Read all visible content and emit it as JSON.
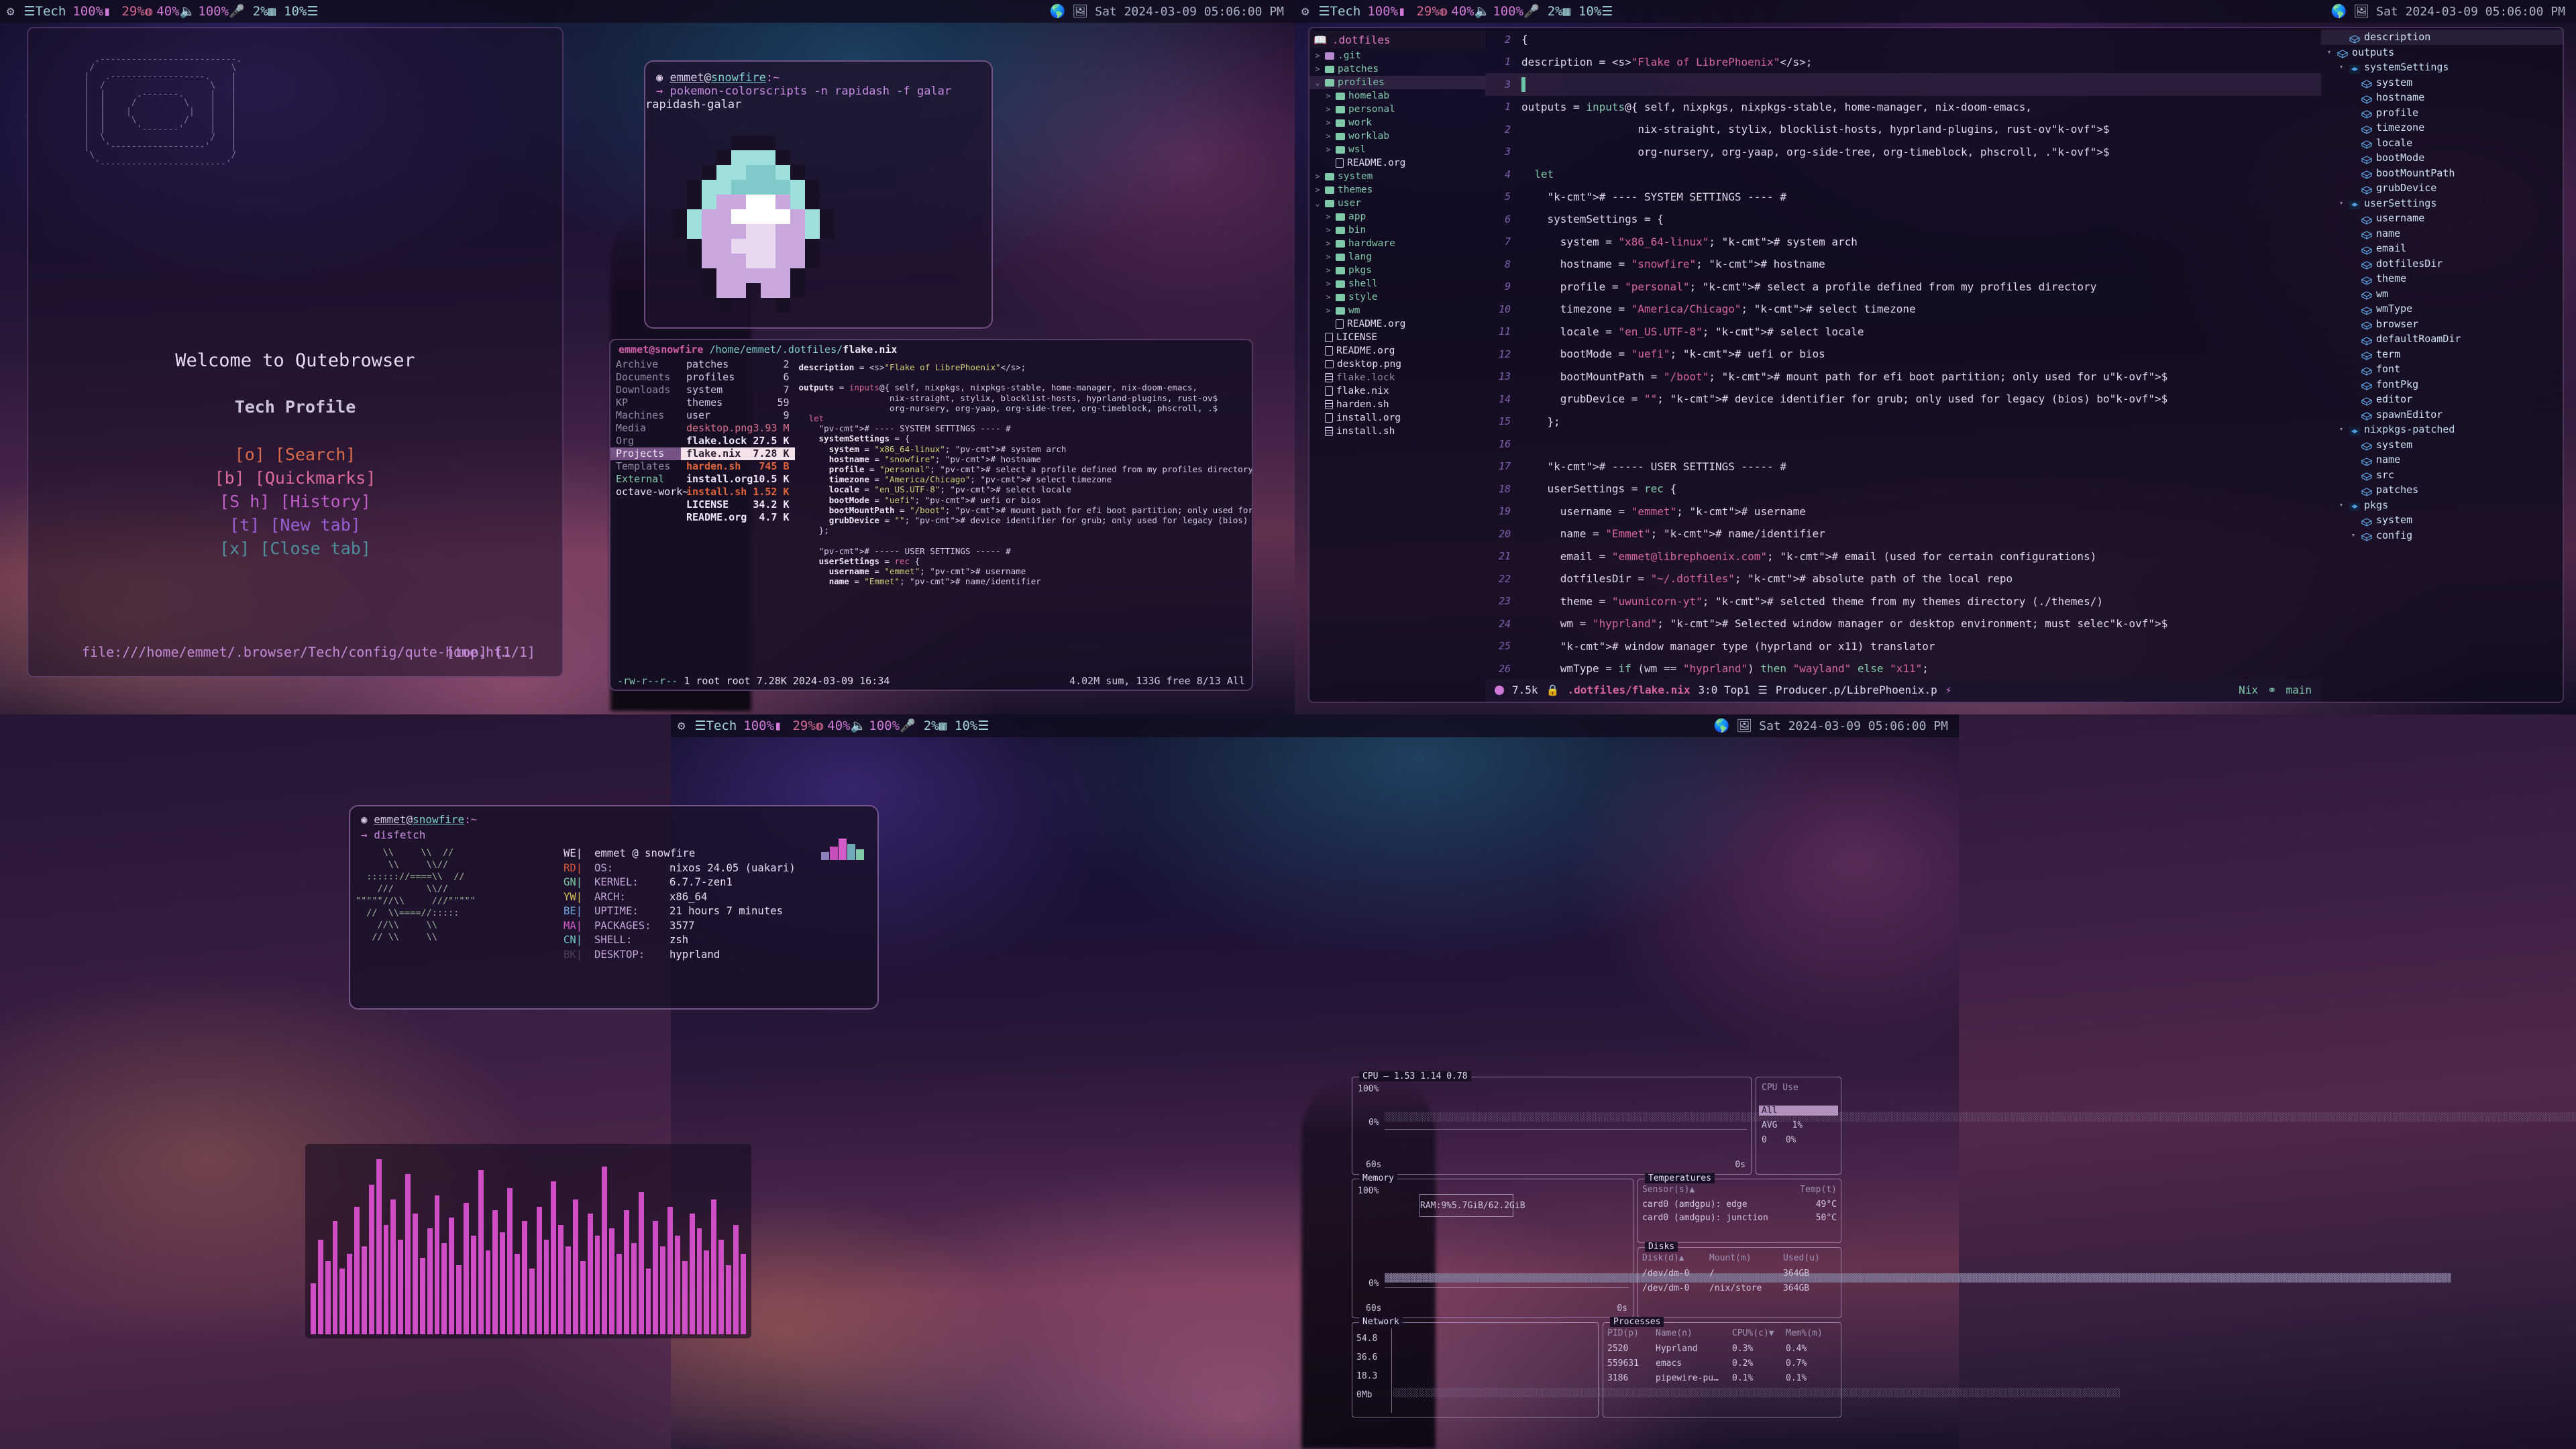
{
  "bar": {
    "left_icons": [
      "gear-icon",
      "layers-icon"
    ],
    "workspace": "Tech",
    "battery_pct": "100%",
    "battery_icon": "battery-icon",
    "cpu_pct": "29%",
    "cpu_icon": "cpu-circle-icon",
    "brightness_pct": "40%",
    "volume_icon": "speaker-icon",
    "volume_pct": "100%",
    "mic_icon": "microphone-icon",
    "mic_pct": "2%",
    "ram_icon": "memory-icon",
    "ram_pct": "10%",
    "menu_icon": "hamburger-icon",
    "datetime": "Sat 2024-03-09 05:06:00 PM",
    "tray": [
      "globe-icon",
      "image-icon"
    ]
  },
  "qutebrowser": {
    "welcome": "Welcome to Qutebrowser",
    "profile": "Tech Profile",
    "links": [
      {
        "key": "[o]",
        "label": "[Search]"
      },
      {
        "key": "[b]",
        "label": "[Quickmarks]"
      },
      {
        "key": "[S h]",
        "label": "[History]"
      },
      {
        "key": "[t]",
        "label": "[New tab]"
      },
      {
        "key": "[x]",
        "label": "[Close tab]"
      }
    ],
    "url": "file:///home/emmet/.browser/Tech/config/qute-home.ht…",
    "position": "[top] [1/1]",
    "ascii_art": "     .--------------------------.\n    /                          \\\n   |   .------------------.    |\n   |  /                    \\   |\n   |  |      .-------.     |   |\n   |  |     /         \\    |   |\n   |  |    |           |   |   |\n   |  |     \\         /    |   |\n   |  |      '-------'     |   |\n   |  \\                    /   |\n   |   '------------------'    |\n    \\                          /\n     '------------------------'"
  },
  "pokemon_terminal": {
    "prompt_user": "emmet",
    "prompt_at": "@",
    "prompt_host": "snowfire",
    "prompt_path": ":~",
    "arrow": "→",
    "command": "pokemon-colorscripts -n rapidash -f galar",
    "output": "rapidash-galar"
  },
  "file_manager": {
    "header_user": "emmet@snowfire",
    "header_path": "/home/emmet/.dotfiles/",
    "header_file": "flake.nix",
    "left_column": [
      {
        "name": "Archive",
        "style": "dim"
      },
      {
        "name": "Documents",
        "style": "dim"
      },
      {
        "name": "Downloads",
        "style": "dim"
      },
      {
        "name": "KP",
        "style": "dim"
      },
      {
        "name": "Machines",
        "style": "dim"
      },
      {
        "name": "Media",
        "style": "dim"
      },
      {
        "name": "Org",
        "style": "dim"
      },
      {
        "name": "Projects",
        "style": "selected"
      },
      {
        "name": "Templates",
        "style": "dim"
      },
      {
        "name": "External",
        "style": "ext"
      },
      {
        "name": "octave-work~",
        "style": "oct"
      }
    ],
    "middle_column": [
      {
        "name": "patches",
        "size": "2",
        "kind": "dir"
      },
      {
        "name": "profiles",
        "size": "6",
        "kind": "dir"
      },
      {
        "name": "system",
        "size": "7",
        "kind": "dir"
      },
      {
        "name": "themes",
        "size": "59",
        "kind": "dir"
      },
      {
        "name": "user",
        "size": "9",
        "kind": "dir"
      },
      {
        "name": "desktop.png",
        "size": "3.93 M",
        "kind": "image"
      },
      {
        "name": "flake.lock",
        "size": "27.5 K",
        "kind": "plain"
      },
      {
        "name": "flake.nix",
        "size": "7.28 K",
        "kind": "selected"
      },
      {
        "name": "harden.sh",
        "size": "745 B",
        "kind": "script"
      },
      {
        "name": "install.org",
        "size": "10.5 K",
        "kind": "plain"
      },
      {
        "name": "install.sh",
        "size": "1.52 K",
        "kind": "script"
      },
      {
        "name": "LICENSE",
        "size": "34.2 K",
        "kind": "plain"
      },
      {
        "name": "README.org",
        "size": "4.7 K",
        "kind": "plain"
      }
    ],
    "status_perm": "-rw-r--r--",
    "status_meta": "1 root root 7.28K 2024-03-09 16:34",
    "status_right": "4.02M sum, 133G free  8/13  All"
  },
  "emacs": {
    "treemacs": {
      "root": ".dotfiles",
      "root_icon": "book-icon",
      "items": [
        {
          "label": ".git",
          "type": "folder-purple",
          "arrow": ">",
          "depth": 0
        },
        {
          "label": "patches",
          "type": "folder",
          "arrow": ">",
          "depth": 0
        },
        {
          "label": "profiles",
          "type": "folder",
          "arrow": "v",
          "depth": 0,
          "highlight": true
        },
        {
          "label": "homelab",
          "type": "folder",
          "arrow": ">",
          "depth": 1
        },
        {
          "label": "personal",
          "type": "folder",
          "arrow": ">",
          "depth": 1
        },
        {
          "label": "work",
          "type": "folder",
          "arrow": ">",
          "depth": 1
        },
        {
          "label": "worklab",
          "type": "folder",
          "arrow": ">",
          "depth": 1
        },
        {
          "label": "wsl",
          "type": "folder",
          "arrow": ">",
          "depth": 1
        },
        {
          "label": "README.org",
          "type": "doc",
          "arrow": "",
          "depth": 1
        },
        {
          "label": "system",
          "type": "folder",
          "arrow": ">",
          "depth": 0
        },
        {
          "label": "themes",
          "type": "folder",
          "arrow": ">",
          "depth": 0
        },
        {
          "label": "user",
          "type": "folder",
          "arrow": "v",
          "depth": 0
        },
        {
          "label": "app",
          "type": "folder",
          "arrow": ">",
          "depth": 1
        },
        {
          "label": "bin",
          "type": "folder",
          "arrow": ">",
          "depth": 1
        },
        {
          "label": "hardware",
          "type": "folder",
          "arrow": ">",
          "depth": 1
        },
        {
          "label": "lang",
          "type": "folder",
          "arrow": ">",
          "depth": 1
        },
        {
          "label": "pkgs",
          "type": "folder",
          "arrow": ">",
          "depth": 1
        },
        {
          "label": "shell",
          "type": "folder",
          "arrow": ">",
          "depth": 1
        },
        {
          "label": "style",
          "type": "folder",
          "arrow": ">",
          "depth": 1
        },
        {
          "label": "wm",
          "type": "folder",
          "arrow": ">",
          "depth": 1
        },
        {
          "label": "README.org",
          "type": "doc",
          "arrow": "",
          "depth": 1
        },
        {
          "label": "LICENSE",
          "type": "doc",
          "arrow": "",
          "depth": 0
        },
        {
          "label": "README.org",
          "type": "doc",
          "arrow": "",
          "depth": 0
        },
        {
          "label": "desktop.png",
          "type": "img",
          "arrow": "",
          "depth": 0
        },
        {
          "label": "flake.lock",
          "type": "bin",
          "arrow": "",
          "depth": 0,
          "dim": true
        },
        {
          "label": "flake.nix",
          "type": "doc",
          "arrow": "",
          "depth": 0
        },
        {
          "label": "harden.sh",
          "type": "bin",
          "arrow": "",
          "depth": 0
        },
        {
          "label": "install.org",
          "type": "doc",
          "arrow": "",
          "depth": 0
        },
        {
          "label": "install.sh",
          "type": "bin",
          "arrow": "",
          "depth": 0
        }
      ]
    },
    "code_lines": [
      {
        "num": "2",
        "indent": 0,
        "html": "{"
      },
      {
        "num": "1",
        "indent": 0,
        "html": "description = <s>\"Flake of LibrePhoenix\"</s>;"
      },
      {
        "num": "3",
        "indent": 0,
        "html": "",
        "current": true
      },
      {
        "num": "1",
        "indent": 0,
        "html": "outputs = inputs@{ self, nixpkgs, nixpkgs-stable, home-manager, nix-doom-emacs,"
      },
      {
        "num": "2",
        "indent": 0,
        "html": "                  nix-straight, stylix, blocklist-hosts, hyprland-plugins, rust-ov$"
      },
      {
        "num": "3",
        "indent": 0,
        "html": "                  org-nursery, org-yaap, org-side-tree, org-timeblock, phscroll, .$"
      },
      {
        "num": "4",
        "indent": 0,
        "html": "  let"
      },
      {
        "num": "5",
        "indent": 0,
        "html": "    # ---- SYSTEM SETTINGS ---- #"
      },
      {
        "num": "6",
        "indent": 0,
        "html": "    systemSettings = {"
      },
      {
        "num": "7",
        "indent": 0,
        "html": "      system = \"x86_64-linux\"; # system arch"
      },
      {
        "num": "8",
        "indent": 0,
        "html": "      hostname = \"snowfire\"; # hostname"
      },
      {
        "num": "9",
        "indent": 0,
        "html": "      profile = \"personal\"; # select a profile defined from my profiles directory"
      },
      {
        "num": "10",
        "indent": 0,
        "html": "      timezone = \"America/Chicago\"; # select timezone"
      },
      {
        "num": "11",
        "indent": 0,
        "html": "      locale = \"en_US.UTF-8\"; # select locale"
      },
      {
        "num": "12",
        "indent": 0,
        "html": "      bootMode = \"uefi\"; # uefi or bios"
      },
      {
        "num": "13",
        "indent": 0,
        "html": "      bootMountPath = \"/boot\"; # mount path for efi boot partition; only used for u$"
      },
      {
        "num": "14",
        "indent": 0,
        "html": "      grubDevice = \"\"; # device identifier for grub; only used for legacy (bios) bo$"
      },
      {
        "num": "15",
        "indent": 0,
        "html": "    };"
      },
      {
        "num": "16",
        "indent": 0,
        "html": ""
      },
      {
        "num": "17",
        "indent": 0,
        "html": "    # ----- USER SETTINGS ----- #"
      },
      {
        "num": "18",
        "indent": 0,
        "html": "    userSettings = rec {"
      },
      {
        "num": "19",
        "indent": 0,
        "html": "      username = \"emmet\"; # username"
      },
      {
        "num": "20",
        "indent": 0,
        "html": "      name = \"Emmet\"; # name/identifier"
      },
      {
        "num": "21",
        "indent": 0,
        "html": "      email = \"emmet@librephoenix.com\"; # email (used for certain configurations)"
      },
      {
        "num": "22",
        "indent": 0,
        "html": "      dotfilesDir = \"~/.dotfiles\"; # absolute path of the local repo"
      },
      {
        "num": "23",
        "indent": 0,
        "html": "      theme = \"uwunicorn-yt\"; # selcted theme from my themes directory (./themes/)"
      },
      {
        "num": "24",
        "indent": 0,
        "html": "      wm = \"hyprland\"; # Selected window manager or desktop environment; must selec$"
      },
      {
        "num": "25",
        "indent": 0,
        "html": "      # window manager type (hyprland or x11) translator"
      },
      {
        "num": "26",
        "indent": 0,
        "html": "      wmType = if (wm == \"hyprland\") then \"wayland\" else \"x11\";"
      }
    ],
    "modeline": {
      "size": "7.5k",
      "lock_icon": "lock-icon",
      "filename": ".dotfiles/flake.nix",
      "position": "3:0 Top1",
      "project_icon": "layers-icon",
      "project": "Producer.p/LibrePhoenix.p",
      "flash_icon": "flash-icon",
      "major_mode": "Nix",
      "branch_icon": "git-branch-icon",
      "branch": "main"
    },
    "imenu": [
      {
        "label": "description",
        "depth": 1,
        "icon": "cube",
        "arrow": "",
        "highlight": true
      },
      {
        "label": "outputs",
        "depth": 0,
        "icon": "cube",
        "arrow": "v"
      },
      {
        "label": "systemSettings",
        "depth": 1,
        "icon": "box",
        "arrow": "v"
      },
      {
        "label": "system",
        "depth": 2,
        "icon": "cube",
        "arrow": ""
      },
      {
        "label": "hostname",
        "depth": 2,
        "icon": "cube",
        "arrow": ""
      },
      {
        "label": "profile",
        "depth": 2,
        "icon": "cube",
        "arrow": ""
      },
      {
        "label": "timezone",
        "depth": 2,
        "icon": "cube",
        "arrow": ""
      },
      {
        "label": "locale",
        "depth": 2,
        "icon": "cube",
        "arrow": ""
      },
      {
        "label": "bootMode",
        "depth": 2,
        "icon": "cube",
        "arrow": ""
      },
      {
        "label": "bootMountPath",
        "depth": 2,
        "icon": "cube",
        "arrow": ""
      },
      {
        "label": "grubDevice",
        "depth": 2,
        "icon": "cube",
        "arrow": ""
      },
      {
        "label": "userSettings",
        "depth": 1,
        "icon": "box",
        "arrow": "v"
      },
      {
        "label": "username",
        "depth": 2,
        "icon": "cube",
        "arrow": ""
      },
      {
        "label": "name",
        "depth": 2,
        "icon": "cube",
        "arrow": ""
      },
      {
        "label": "email",
        "depth": 2,
        "icon": "cube",
        "arrow": ""
      },
      {
        "label": "dotfilesDir",
        "depth": 2,
        "icon": "cube",
        "arrow": ""
      },
      {
        "label": "theme",
        "depth": 2,
        "icon": "cube",
        "arrow": ""
      },
      {
        "label": "wm",
        "depth": 2,
        "icon": "cube",
        "arrow": ""
      },
      {
        "label": "wmType",
        "depth": 2,
        "icon": "cube",
        "arrow": ""
      },
      {
        "label": "browser",
        "depth": 2,
        "icon": "cube",
        "arrow": ""
      },
      {
        "label": "defaultRoamDir",
        "depth": 2,
        "icon": "cube",
        "arrow": ""
      },
      {
        "label": "term",
        "depth": 2,
        "icon": "cube",
        "arrow": ""
      },
      {
        "label": "font",
        "depth": 2,
        "icon": "cube",
        "arrow": ""
      },
      {
        "label": "fontPkg",
        "depth": 2,
        "icon": "cube",
        "arrow": ""
      },
      {
        "label": "editor",
        "depth": 2,
        "icon": "cube",
        "arrow": ""
      },
      {
        "label": "spawnEditor",
        "depth": 2,
        "icon": "cube",
        "arrow": ""
      },
      {
        "label": "nixpkgs-patched",
        "depth": 1,
        "icon": "box",
        "arrow": "v"
      },
      {
        "label": "system",
        "depth": 2,
        "icon": "cube",
        "arrow": ""
      },
      {
        "label": "name",
        "depth": 2,
        "icon": "cube",
        "arrow": ""
      },
      {
        "label": "src",
        "depth": 2,
        "icon": "cube",
        "arrow": ""
      },
      {
        "label": "patches",
        "depth": 2,
        "icon": "cube",
        "arrow": ""
      },
      {
        "label": "pkgs",
        "depth": 1,
        "icon": "box",
        "arrow": "v"
      },
      {
        "label": "system",
        "depth": 2,
        "icon": "cube",
        "arrow": ""
      },
      {
        "label": "config",
        "depth": 2,
        "icon": "cube",
        "arrow": "v"
      }
    ]
  },
  "fastfetch": {
    "prompt_user": "emmet",
    "prompt_host": "snowfire",
    "prompt_path": ":~",
    "arrow": "→",
    "command": "disfetch",
    "ascii": "     \\\\     \\\\  //\n      \\\\     \\\\//\n  :::::://====\\\\  //\n    ///      \\\\//\n\"\"\"\"\"//\\\\     ///\"\"\"\"\"\n  //  \\\\====//:::::\n    //\\\\     \\\\\n   // \\\\     \\\\",
    "title": "emmet @ snowfire",
    "tags": [
      "WE",
      "RD",
      "GN",
      "YW",
      "BE",
      "MA",
      "CN",
      "BK"
    ],
    "rows": [
      {
        "key": "OS:",
        "value": "nixos 24.05 (uakari)"
      },
      {
        "key": "KERNEL:",
        "value": "6.7.7-zen1"
      },
      {
        "key": "ARCH:",
        "value": "x86_64"
      },
      {
        "key": "UPTIME:",
        "value": "21 hours 7 minutes"
      },
      {
        "key": "PACKAGES:",
        "value": "3577"
      },
      {
        "key": "SHELL:",
        "value": "zsh"
      },
      {
        "key": "DESKTOP:",
        "value": "hyprland"
      }
    ]
  },
  "btop": {
    "cpu": {
      "title": "CPU",
      "load": "1.53 1.14 0.78",
      "y_top": "100%",
      "y_bot": "0%",
      "x_left": "60s",
      "x_right": "0s",
      "side_title": "CPU  Use",
      "side_all": "All",
      "side_avg_label": "AVG",
      "side_avg_value": "1%",
      "side_core0_label": "0",
      "side_core0_value": "0%"
    },
    "memory": {
      "title": "Memory",
      "y_top": "100%",
      "y_bot": "0%",
      "x_left": "60s",
      "x_right": "0s",
      "ram_label": "RAM:",
      "ram_pct": "9%",
      "ram_used": "5.7GiB/62.2GiB"
    },
    "temperatures": {
      "title": "Temperatures",
      "col_sensor": "Sensor(s)▲",
      "col_temp": "Temp(t)",
      "rows": [
        {
          "sensor": "card0 (amdgpu): edge",
          "temp": "49°C"
        },
        {
          "sensor": "card0 (amdgpu): junction",
          "temp": "50°C"
        }
      ]
    },
    "disks": {
      "title": "Disks",
      "col_disk": "Disk(d)▲",
      "col_mount": "Mount(m)",
      "col_used": "Used(u)",
      "rows": [
        {
          "disk": "/dev/dm-0",
          "mount": "/",
          "used": "364GB"
        },
        {
          "disk": "/dev/dm-0",
          "mount": "/nix/store",
          "used": "364GB"
        }
      ]
    },
    "network": {
      "title": "Network",
      "ticks": [
        "54.8",
        "36.6",
        "18.3",
        "0Mb"
      ]
    },
    "processes": {
      "title": "Processes",
      "col_pid": "PID(p)",
      "col_name": "Name(n)",
      "col_cpu": "CPU%(c)▼",
      "col_mem": "Mem%(m)",
      "rows": [
        {
          "pid": "2520",
          "name": "Hyprland",
          "cpu": "0.3%",
          "mem": "0.4%"
        },
        {
          "pid": "559631",
          "name": "emacs",
          "cpu": "0.2%",
          "mem": "0.7%"
        },
        {
          "pid": "3186",
          "name": "pipewire-pu…",
          "cpu": "0.1%",
          "mem": "0.1%"
        }
      ]
    }
  },
  "visualizer": {
    "bar_color": "#cf4ec6",
    "values": [
      28,
      52,
      40,
      62,
      36,
      44,
      70,
      48,
      82,
      96,
      60,
      74,
      52,
      88,
      66,
      42,
      58,
      76,
      50,
      64,
      38,
      72,
      54,
      90,
      46,
      68,
      56,
      80,
      44,
      62,
      36,
      70,
      52,
      84,
      60,
      48,
      74,
      40,
      66,
      54,
      92,
      58,
      44,
      68,
      50,
      78,
      36,
      62,
      48,
      70,
      54,
      40,
      66,
      58,
      46,
      74,
      52,
      38,
      60,
      44
    ]
  }
}
